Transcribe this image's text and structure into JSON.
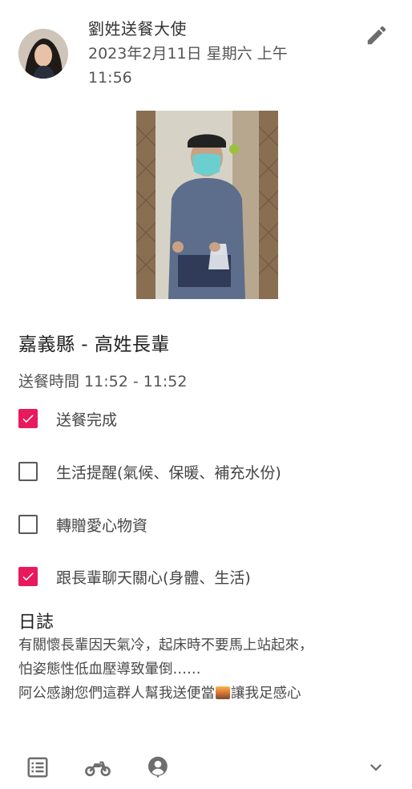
{
  "post": {
    "author": "劉姓送餐大使",
    "date_line1": "2023年2月11日 星期六 上午",
    "date_line2": "11:56",
    "location": "嘉義縣 - 高姓長輩",
    "time_range": "送餐時間 11:52 - 11:52"
  },
  "checklist": [
    {
      "label": "送餐完成",
      "checked": true
    },
    {
      "label": "生活提醒(氣候、保暖、補充水份)",
      "checked": false
    },
    {
      "label": "轉贈愛心物資",
      "checked": false
    },
    {
      "label": "跟長輩聊天關心(身體、生活)",
      "checked": true
    }
  ],
  "log": {
    "heading": "日誌",
    "line1": "有關懷長輩因天氣冷，起床時不要馬上站起來，",
    "line2": "怕姿態性低血壓導致暈倒……",
    "line3a": "阿公感謝您們這群人幫我送便當",
    "line3b": "讓我足感心"
  },
  "icons": {
    "edit": "pencil-icon",
    "list": "list-icon",
    "delivery": "motorcycle-icon",
    "profile": "person-pin-icon",
    "expand": "chevron-down-icon"
  },
  "colors": {
    "accent": "#e8195c",
    "icon": "#6e6e6e"
  }
}
